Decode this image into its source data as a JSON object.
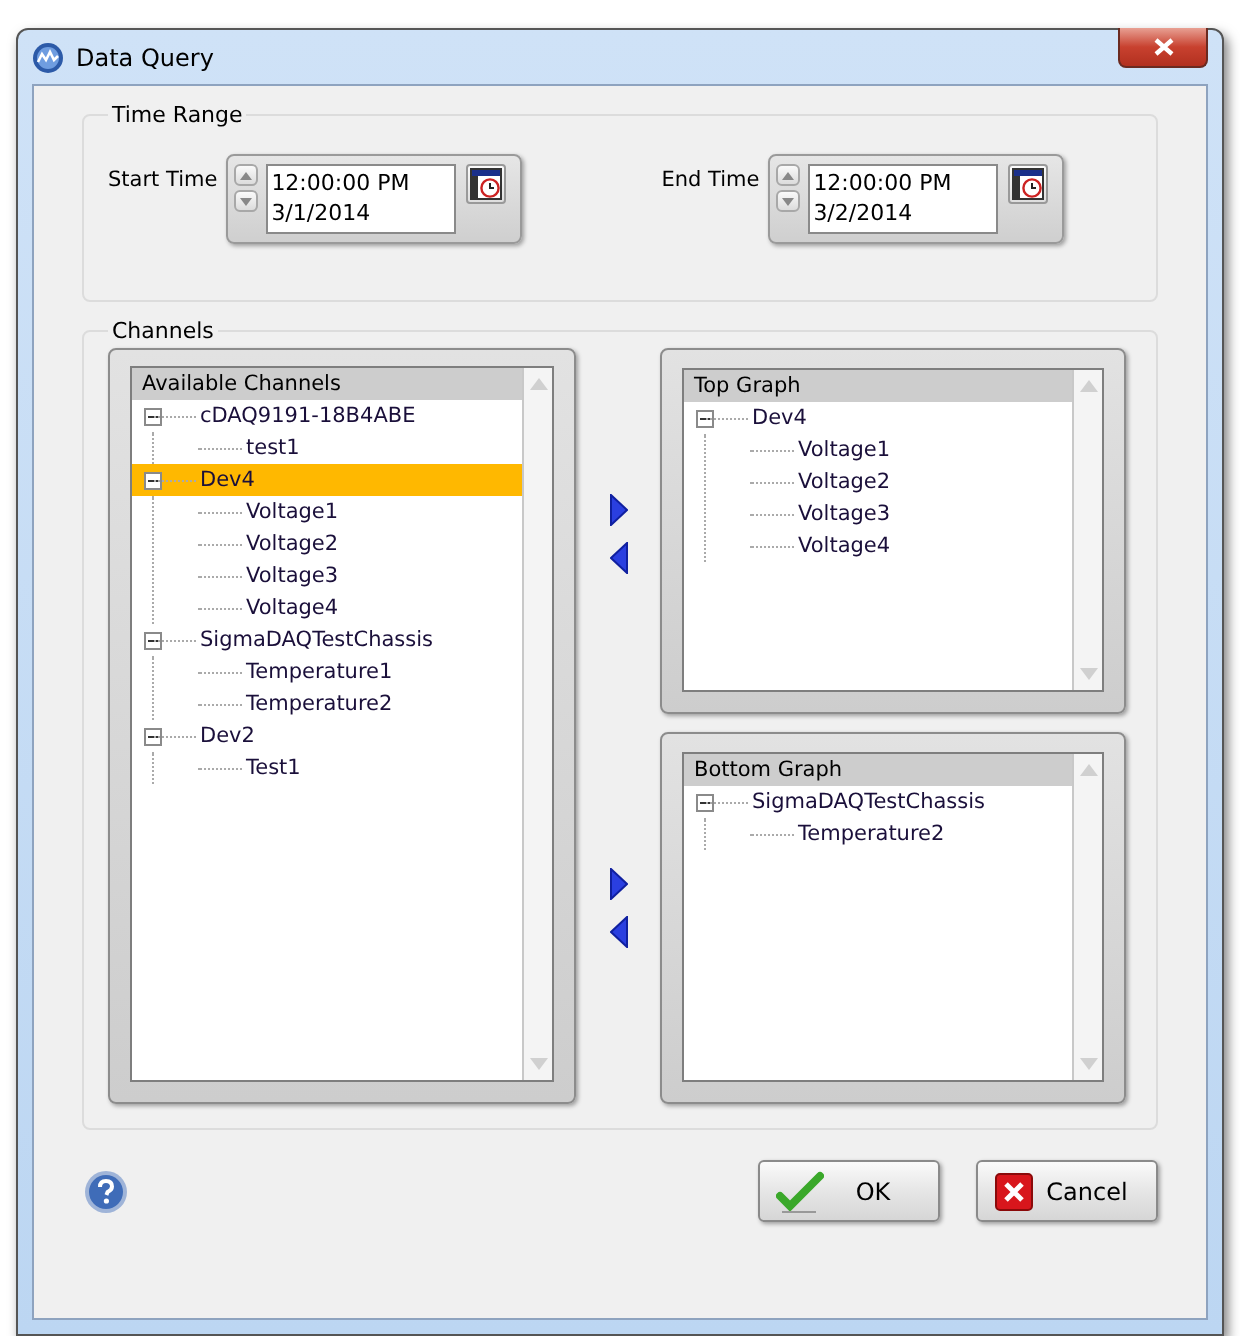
{
  "window": {
    "title": "Data Query"
  },
  "time_range": {
    "title": "Time Range",
    "pickers": [
      {
        "label": "Start Time",
        "time": "12:00:00 PM",
        "date": "3/1/2014"
      },
      {
        "label": "End Time",
        "time": "12:00:00 PM",
        "date": "3/2/2014"
      }
    ]
  },
  "channels": {
    "title": "Channels",
    "available": {
      "header": "Available Channels",
      "nodes": [
        {
          "label": "cDAQ9191-18B4ABE",
          "expanded": true,
          "selected": false,
          "children": [
            {
              "label": "test1",
              "selected": false
            }
          ]
        },
        {
          "label": "Dev4",
          "expanded": true,
          "selected": true,
          "children": [
            {
              "label": "Voltage1",
              "selected": false
            },
            {
              "label": "Voltage2",
              "selected": false
            },
            {
              "label": "Voltage3",
              "selected": false
            },
            {
              "label": "Voltage4",
              "selected": false
            }
          ]
        },
        {
          "label": "SigmaDAQTestChassis",
          "expanded": true,
          "selected": false,
          "children": [
            {
              "label": "Temperature1",
              "selected": false
            },
            {
              "label": "Temperature2",
              "selected": false
            }
          ]
        },
        {
          "label": "Dev2",
          "expanded": true,
          "selected": false,
          "children": [
            {
              "label": "Test1",
              "selected": false
            }
          ]
        }
      ]
    },
    "top_graph": {
      "header": "Top Graph",
      "nodes": [
        {
          "label": "Dev4",
          "expanded": true,
          "selected": false,
          "children": [
            {
              "label": "Voltage1",
              "selected": false
            },
            {
              "label": "Voltage2",
              "selected": false
            },
            {
              "label": "Voltage3",
              "selected": false
            },
            {
              "label": "Voltage4",
              "selected": false
            }
          ]
        }
      ]
    },
    "bottom_graph": {
      "header": "Bottom Graph",
      "nodes": [
        {
          "label": "SigmaDAQTestChassis",
          "expanded": true,
          "selected": false,
          "children": [
            {
              "label": "Temperature2",
              "selected": false
            }
          ]
        }
      ]
    }
  },
  "buttons": [
    {
      "label": "OK",
      "kind": "ok"
    },
    {
      "label": "Cancel",
      "kind": "cancel"
    }
  ]
}
